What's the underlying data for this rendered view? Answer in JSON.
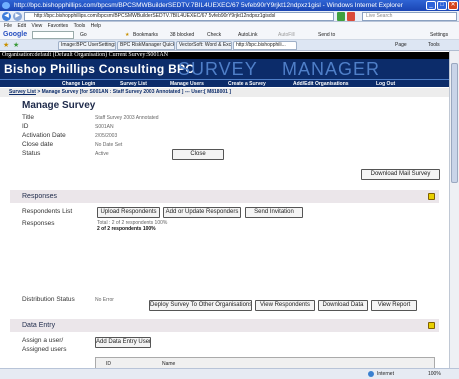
{
  "window": {
    "title": "http://bpc.bishopphillips.com/bpcsm/BPCSMWBuilderSEDTV.7BIL4UEXEC/67 5vfeb90rY9rjkt12ndpxz1gisl - Windows Internet Explorer",
    "min_glyph": "_",
    "max_glyph": "□",
    "close_glyph": "✕"
  },
  "addressbar": {
    "back_glyph": "◀",
    "forward_glyph": "▶",
    "url": "http://bpc.bishopphillips.com/bpcsm/BPCSMWBuilderSEDTV.7BIL4UEXEC/67 5vfeb90rY9rjkt12ndpxz1gisdsl",
    "live_search_placeholder": "Live Search"
  },
  "menu": [
    "File",
    "Edit",
    "View",
    "Favorites",
    "Tools",
    "Help"
  ],
  "googlebar": {
    "logo": "Google",
    "go_label": "Go",
    "bookmarks": "Bookmarks",
    "blocked": "38 blocked",
    "check": "Check",
    "autolink": "AutoLink",
    "autofill": "AutoFill",
    "sendto": "Send to",
    "settings": "Settings"
  },
  "tabs": [
    "Image:BPC UserSettings ...",
    "BPC RiskManager Quick H...",
    "VectorSoft: Word & Excel...",
    "http://bpc.bishopphili..."
  ],
  "tools": {
    "page_label": "Page",
    "tools_label": "Tools"
  },
  "page": {
    "org_line": "Organisation:default (Default Organisation) Current Survey:S001AN",
    "brand": "Bishop Phillips Consulting BPC",
    "logo_survey": "SURVEY",
    "logo_manager": "MANAGER",
    "nav": [
      "Change Login",
      "Survey List",
      "Manage Users",
      "Create a Survey",
      "Add/Edit Organisations",
      "Log Out"
    ],
    "breadcrumb": {
      "link": "Survey List",
      "rest": " > Manage Survey [for S001AN : Staff Survey 2003 Annotated ] --- User:[ M818001 ]"
    },
    "title": "Manage Survey",
    "fields": [
      {
        "label": "Title",
        "value": "Staff Survey 2003 Annotated"
      },
      {
        "label": "ID",
        "value": "S001AN"
      },
      {
        "label": "Activation Date",
        "value": "2/05/2003"
      },
      {
        "label": "Close date",
        "value": "No Date Set"
      },
      {
        "label": "Status",
        "value": "Active"
      }
    ],
    "close_button": "Close",
    "download_mail_button": "Download Mail Survey",
    "responses_section": "Responses",
    "respondents_list_label": "Respondents List",
    "upload_respondents": "Upload Respondents",
    "add_update_respondents": "Add or Update Responders",
    "send_invitation": "Send Invitation",
    "responses_label": "Responses",
    "responses_total": "Total : 2 of 2 respondents 100%",
    "responses_detail": "2 of 2 respondents 100%",
    "distribution_label": "Distribution Status",
    "distribution_value": "No Error",
    "deploy_button": "Deploy Survey To Other Organisations",
    "view_respondents": "View Respondents",
    "download_data": "Download Data",
    "view_report": "View Report",
    "data_entry_section": "Data Entry",
    "assign_label": "Assign a user/",
    "assigned_label": "Assigned users",
    "add_data_entry_user": "Add Data Entry User",
    "table_headers": [
      "ID",
      "Name"
    ]
  },
  "status": {
    "zone": "Internet",
    "zoom": "100%"
  }
}
